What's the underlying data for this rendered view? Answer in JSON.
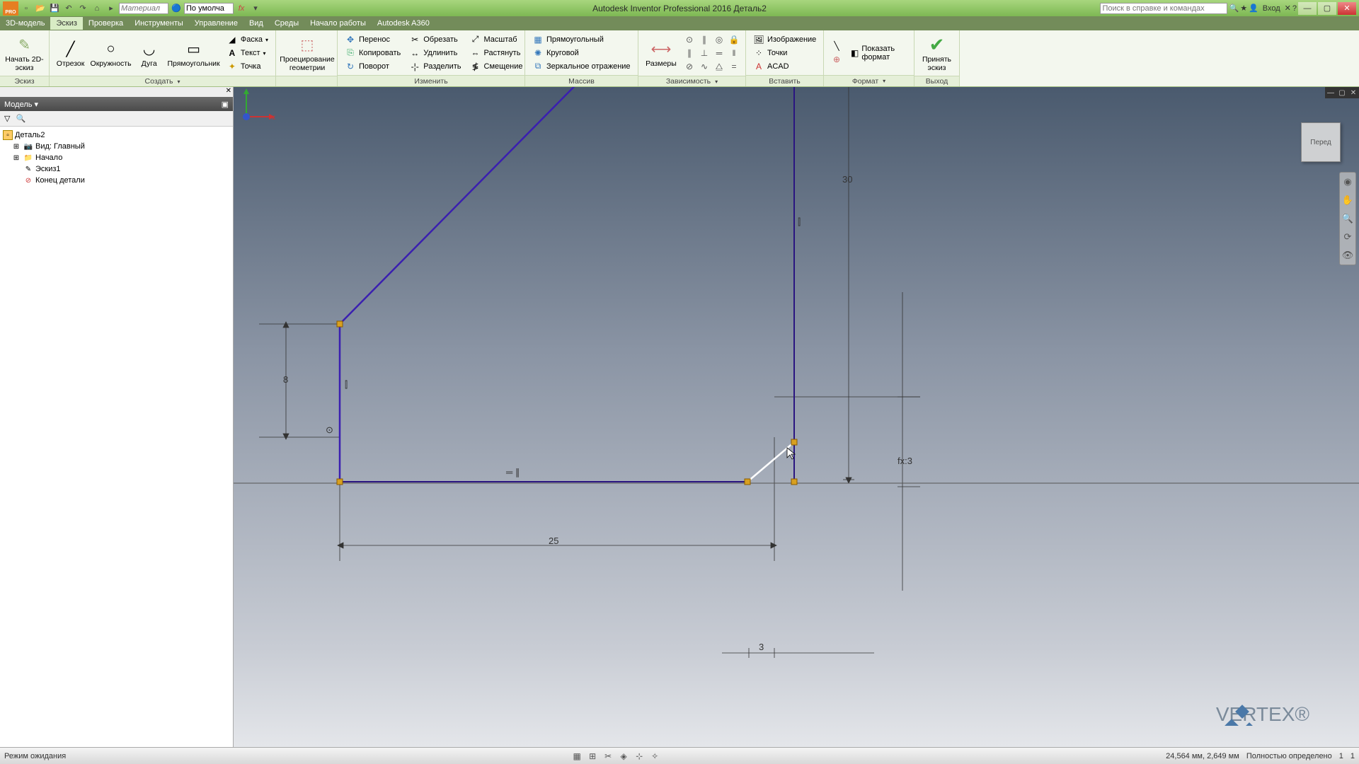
{
  "title": "Autodesk Inventor Professional 2016   Деталь2",
  "qat": {
    "material_placeholder": "Материал",
    "appearance_placeholder": "По умолча"
  },
  "search_placeholder": "Поиск в справке и командах",
  "login": "Вход",
  "menus": [
    "3D-модель",
    "Эскиз",
    "Проверка",
    "Инструменты",
    "Управление",
    "Вид",
    "Среды",
    "Начало работы",
    "Autodesk A360"
  ],
  "ribbon": {
    "sketch": {
      "label": "Эскиз",
      "start": "Начать 2D-эскиз"
    },
    "create": {
      "label": "Создать",
      "line": "Отрезок",
      "circle": "Окружность",
      "arc": "Дуга",
      "rect": "Прямоугольник",
      "fillet": "Фаска",
      "text": "Текст",
      "point": "Точка",
      "project": "Проецирование геометрии"
    },
    "modify": {
      "label": "Изменить",
      "move": "Перенос",
      "copy": "Копировать",
      "rotate": "Поворот",
      "trim": "Обрезать",
      "extend": "Удлинить",
      "split": "Разделить",
      "scale": "Масштаб",
      "stretch": "Растянуть",
      "offset": "Смещение"
    },
    "pattern": {
      "label": "Массив",
      "rect": "Прямоугольный",
      "circ": "Круговой",
      "mirror": "Зеркальное отражение"
    },
    "constrain": {
      "label": "Зависимость",
      "dim": "Размеры"
    },
    "insert": {
      "label": "Вставить",
      "image": "Изображение",
      "points": "Точки",
      "acad": "ACAD"
    },
    "format": {
      "label": "Формат",
      "show": "Показать формат"
    },
    "exit": {
      "label": "Выход",
      "finish": "Принять эскиз"
    }
  },
  "browser": {
    "title": "Модель",
    "root": "Деталь2",
    "view": "Вид: Главный",
    "origin": "Начало",
    "sketch": "Эскиз1",
    "end": "Конец детали"
  },
  "dimensions": {
    "d8": "8",
    "d25": "25",
    "d3": "3",
    "d30": "30",
    "dfx3": "fx:3"
  },
  "viewcube": "Перед",
  "watermark": "VERTEX®",
  "status": {
    "mode": "Режим ожидания",
    "coords": "24,564 мм, 2,649 мм",
    "defined": "Полностью определено",
    "n1": "1",
    "n2": "1"
  }
}
